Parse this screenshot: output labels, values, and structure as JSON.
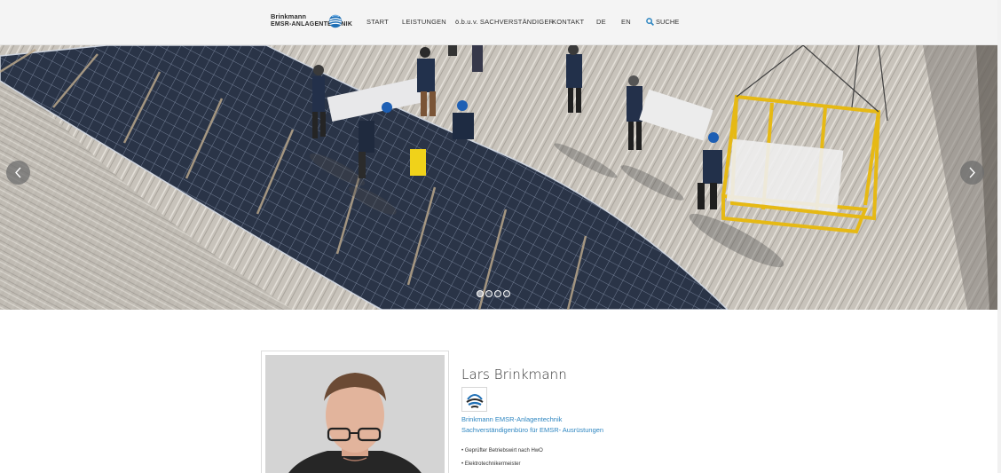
{
  "header": {
    "logo_line1": "Brinkmann",
    "logo_line2": "EMSR-ANLAGENTECHNIK",
    "nav": [
      {
        "label": "START"
      },
      {
        "label": "LEISTUNGEN"
      },
      {
        "label": "ö.b.u.v. SACHVERSTÄNDIGER"
      },
      {
        "label": "KONTAKT"
      },
      {
        "label": "DE"
      },
      {
        "label": "EN"
      }
    ],
    "search_label": "SUCHE"
  },
  "slider": {
    "slide_count": 4,
    "active_slide": 1,
    "prev_icon": "chevron-left-icon",
    "next_icon": "chevron-right-icon"
  },
  "profile": {
    "name": "Lars Brinkmann",
    "company_line1": "Brinkmann EMSR-Anlagentechnik",
    "company_line2": "Sachverständigenbüro für EMSR- Ausrüstungen",
    "qualifications": [
      "• Geprüfter Betriebswirt nach HwO",
      "• Elektrotechnikermeister"
    ]
  },
  "colors": {
    "link": "#2e86c1",
    "search_icon": "#2e86c1",
    "header_bg": "#f4f4f4"
  }
}
